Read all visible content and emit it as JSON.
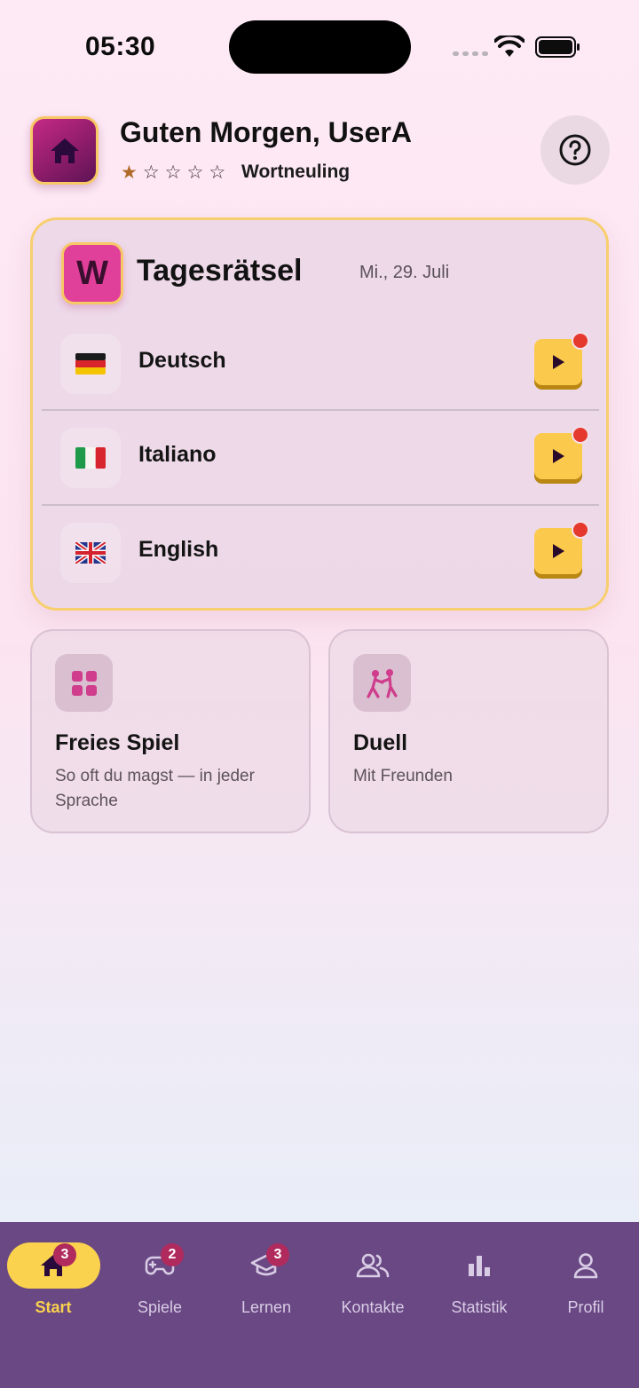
{
  "status_bar": {
    "time": "05:30"
  },
  "header": {
    "greeting": "Guten Morgen, UserA",
    "stars": {
      "filled": 1,
      "total": 5
    },
    "rank": "Wortneuling",
    "help_icon": "question-circle-icon",
    "home_icon": "home-icon"
  },
  "daily": {
    "badge_letter": "W",
    "title": "Tagesrätsel",
    "date": "Mi., 29. Juli",
    "languages": [
      {
        "name": "Deutsch",
        "flag": "german-flag-icon"
      },
      {
        "name": "Italiano",
        "flag": "italian-flag-icon"
      },
      {
        "name": "English",
        "flag": "uk-flag-icon"
      }
    ]
  },
  "cards": {
    "free_play": {
      "title": "Freies Spiel",
      "subtitle": "So oft du magst — in jeder Sprache",
      "icon": "grid-icon"
    },
    "duel": {
      "title": "Duell",
      "subtitle": "Mit Freunden",
      "icon": "duel-icon"
    }
  },
  "tabbar": {
    "items": [
      {
        "label": "Start",
        "badge": "3",
        "icon": "home-icon",
        "active": true
      },
      {
        "label": "Spiele",
        "badge": "2",
        "icon": "gamepad-icon"
      },
      {
        "label": "Lernen",
        "badge": "3",
        "icon": "graduation-cap-icon"
      },
      {
        "label": "Kontakte",
        "icon": "contacts-icon"
      },
      {
        "label": "Statistik",
        "icon": "bar-chart-icon"
      },
      {
        "label": "Profil",
        "icon": "person-icon"
      }
    ]
  },
  "colors": {
    "accent_yellow": "#fbd24e",
    "brand_pink": "#e0409a",
    "tabbar_purple": "#694884",
    "notification_red": "#e5392e"
  }
}
